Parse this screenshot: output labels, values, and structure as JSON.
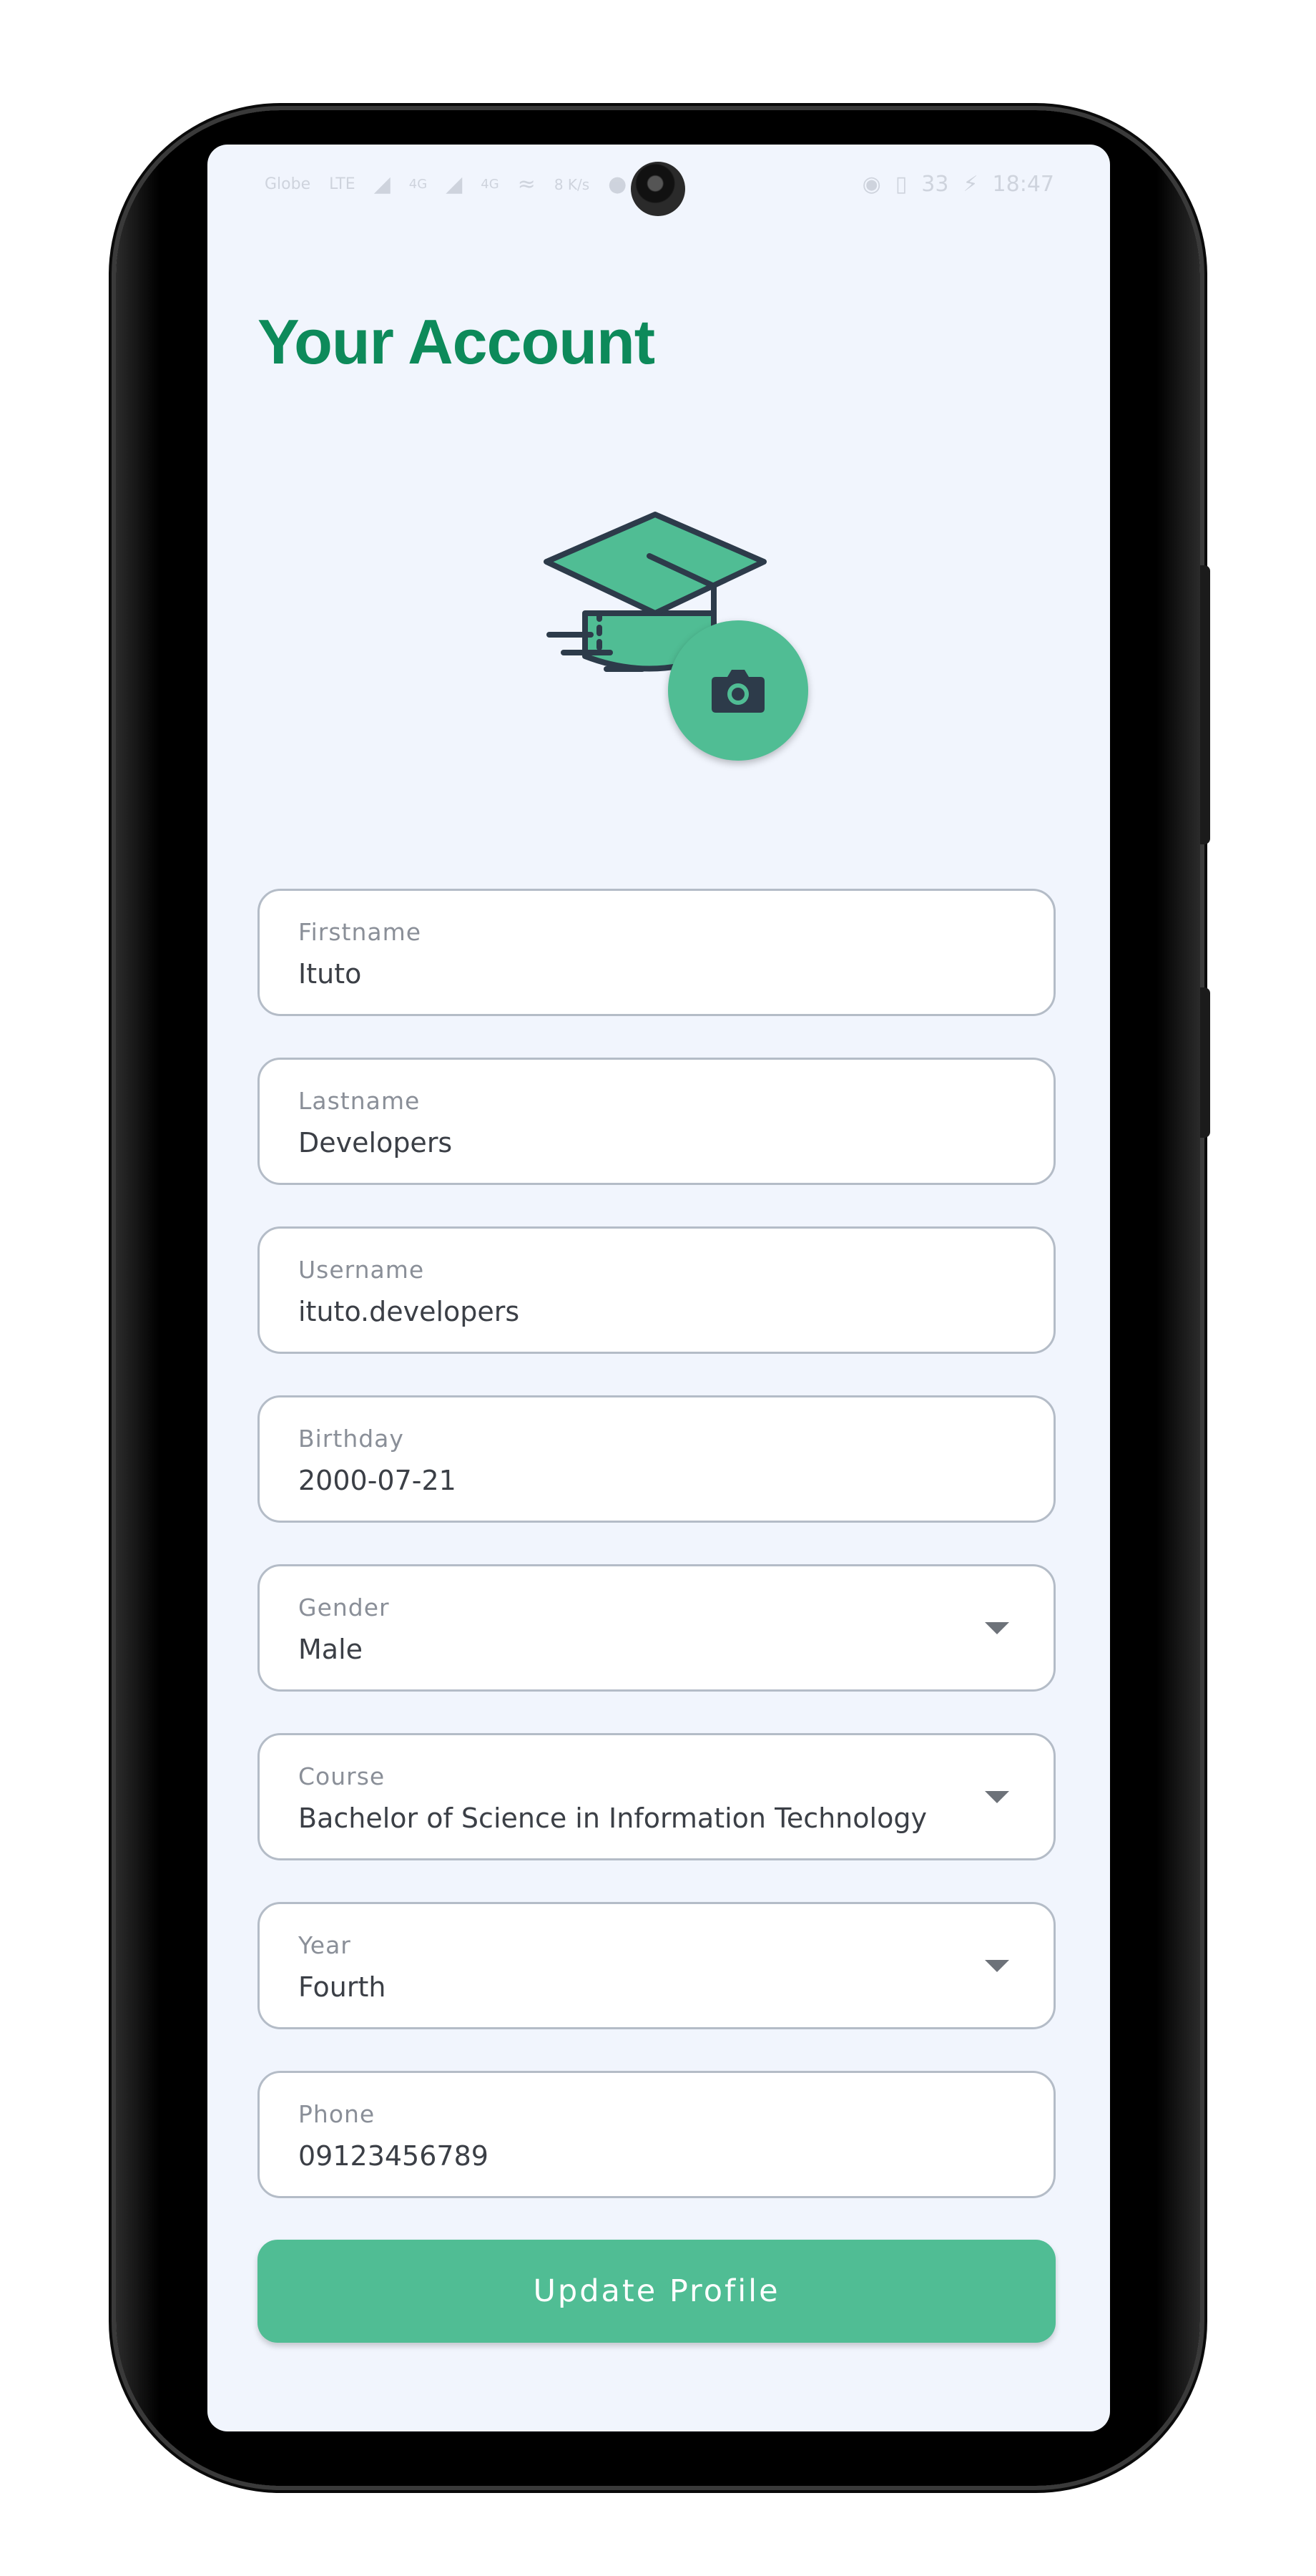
{
  "status_bar": {
    "carrier": "Globe",
    "network": "LTE",
    "signal_1": "4G",
    "signal_2": "4G",
    "speed": "8 K/s",
    "battery": "33",
    "time": "18:47"
  },
  "page": {
    "title": "Your Account"
  },
  "icons": {
    "logo": "graduation-cap-logo",
    "photo_button": "camera-icon",
    "dropdown": "dropdown-arrow-icon"
  },
  "colors": {
    "accent": "#50bd94",
    "title": "#0d8a5a",
    "background": "#f1f5fd",
    "border": "#b4bcc7",
    "icon_dark": "#2d3b4a"
  },
  "form": {
    "firstname": {
      "label": "Firstname",
      "value": "Ituto"
    },
    "lastname": {
      "label": "Lastname",
      "value": "Developers"
    },
    "username": {
      "label": "Username",
      "value": "ituto.developers"
    },
    "birthday": {
      "label": "Birthday",
      "value": "2000-07-21"
    },
    "gender": {
      "label": "Gender",
      "value": "Male"
    },
    "course": {
      "label": "Course",
      "value": "Bachelor of Science in Information Technology"
    },
    "year": {
      "label": "Year",
      "value": "Fourth"
    },
    "phone": {
      "label": "Phone",
      "value": "09123456789"
    }
  },
  "actions": {
    "update_label": "Update Profile"
  }
}
